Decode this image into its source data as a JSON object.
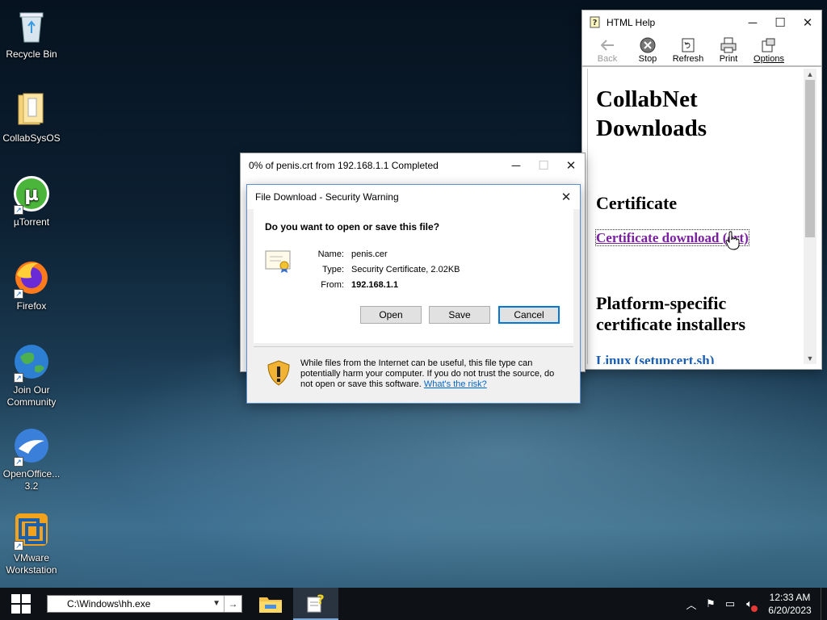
{
  "desktop": {
    "icons": [
      {
        "label": "Recycle Bin"
      },
      {
        "label": "CollabSysOS"
      },
      {
        "label": "µTorrent"
      },
      {
        "label": "Firefox"
      },
      {
        "label": "Join Our Community"
      },
      {
        "label": "OpenOffice... 3.2"
      },
      {
        "label": "VMware Workstation"
      }
    ]
  },
  "help_window": {
    "title": "HTML Help",
    "toolbar": {
      "back": "Back",
      "stop": "Stop",
      "refresh": "Refresh",
      "print": "Print",
      "options": "Options"
    },
    "content": {
      "heading": "CollabNet Downloads",
      "section1": "Certificate",
      "cert_link": "Certificate download (crt)",
      "section2": "Platform-specific certificate installers",
      "linux_link": "Linux (setupcert.sh)"
    }
  },
  "progress_window": {
    "title": "0% of penis.crt from 192.168.1.1 Completed"
  },
  "security_dialog": {
    "title": "File Download - Security Warning",
    "question": "Do you want to open or save this file?",
    "name_label": "Name:",
    "name_value": "penis.cer",
    "type_label": "Type:",
    "type_value": "Security Certificate, 2.02KB",
    "from_label": "From:",
    "from_value": "192.168.1.1",
    "open_button": "Open",
    "save_button": "Save",
    "cancel_button": "Cancel",
    "warning_text": "While files from the Internet can be useful, this file type can potentially harm your computer. If you do not trust the source, do not open or save this software.",
    "risk_link": "What's the risk?"
  },
  "taskbar": {
    "run_value": "C:\\Windows\\hh.exe",
    "time": "12:33 AM",
    "date": "6/20/2023"
  }
}
